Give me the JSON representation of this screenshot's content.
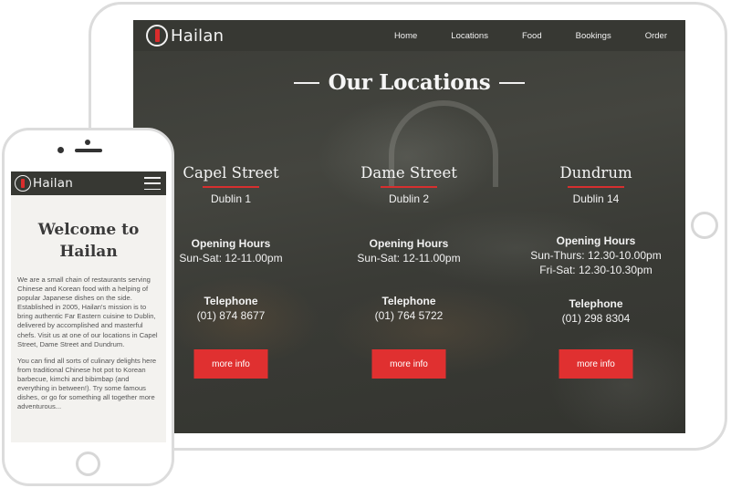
{
  "desktop": {
    "brand": "Hailan",
    "nav": [
      {
        "label": "Home"
      },
      {
        "label": "Locations"
      },
      {
        "label": "Food"
      },
      {
        "label": "Bookings"
      },
      {
        "label": "Order"
      }
    ],
    "section_title": "Our Locations",
    "locations": [
      {
        "name": "Capel Street",
        "area": "Dublin 1",
        "hours_label": "Opening Hours",
        "hours": [
          "Sun-Sat: 12-11.00pm"
        ],
        "tel_label": "Telephone",
        "tel": "(01) 874 8677",
        "button": "more info"
      },
      {
        "name": "Dame Street",
        "area": "Dublin 2",
        "hours_label": "Opening Hours",
        "hours": [
          "Sun-Sat: 12-11.00pm"
        ],
        "tel_label": "Telephone",
        "tel": "(01) 764 5722",
        "button": "more info"
      },
      {
        "name": "Dundrum",
        "area": "Dublin 14",
        "hours_label": "Opening Hours",
        "hours": [
          "Sun-Thurs: 12.30-10.00pm",
          "Fri-Sat: 12.30-10.30pm"
        ],
        "tel_label": "Telephone",
        "tel": "(01) 298 8304",
        "button": "more info"
      }
    ]
  },
  "mobile": {
    "brand": "Hailan",
    "title": "Welcome to Hailan",
    "paragraphs": [
      "We are a small chain of restaurants serving Chinese and Korean food with a helping of popular Japanese dishes on the side. Established in 2005, Hailan's mission is to bring authentic Far Eastern cuisine to Dublin, delivered by accomplished and masterful chefs. Visit us at one of our locations in Capel Street, Dame Street and Dundrum.",
      "You can find all sorts of culinary delights here from traditional Chinese hot pot to Korean barbecue, kimchi and bibimbap (and everything in between!). Try some famous dishes, or go for something all together more adventurous..."
    ]
  },
  "colors": {
    "accent": "#e03030",
    "nav_bg": "#373833",
    "mobile_bg": "#f3f2ef",
    "device_frame": "#dcdcdc"
  }
}
